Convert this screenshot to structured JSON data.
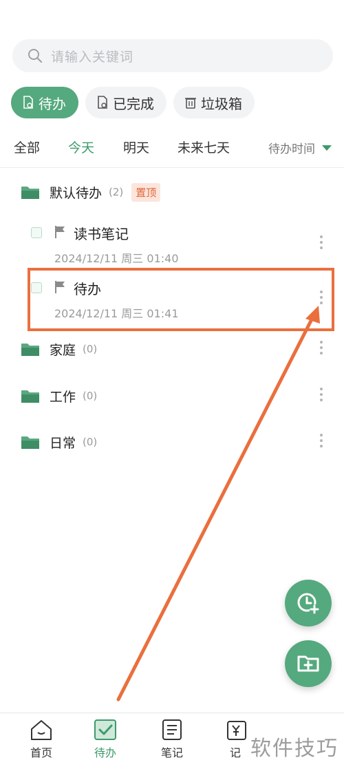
{
  "search": {
    "placeholder": "请输入关键词",
    "icon": "search-icon"
  },
  "chips": [
    {
      "label": "待办",
      "icon": "todo-doc-icon",
      "active": true
    },
    {
      "label": "已完成",
      "icon": "done-doc-icon",
      "active": false
    },
    {
      "label": "垃圾箱",
      "icon": "trash-icon",
      "active": false
    }
  ],
  "tabs": [
    {
      "label": "全部",
      "active": false
    },
    {
      "label": "今天",
      "active": true
    },
    {
      "label": "明天",
      "active": false
    },
    {
      "label": "未来七天",
      "active": false
    }
  ],
  "sort": {
    "label": "待办时间",
    "icon": "triangle-down-icon"
  },
  "folders": [
    {
      "name": "默认待办",
      "count": "(2)",
      "badge": "置顶",
      "tasks": [
        {
          "title": "读书笔记",
          "date": "2024/12/11 周三 01:40"
        },
        {
          "title": "待办",
          "date": "2024/12/11 周三 01:41"
        }
      ]
    },
    {
      "name": "家庭",
      "count": "(0)"
    },
    {
      "name": "工作",
      "count": "(0)"
    },
    {
      "name": "日常",
      "count": "(0)"
    }
  ],
  "fabs": [
    {
      "icon": "clock-add-icon"
    },
    {
      "icon": "folder-add-icon"
    }
  ],
  "bottom_nav": [
    {
      "label": "首页",
      "icon": "home-icon",
      "active": false
    },
    {
      "label": "待办",
      "icon": "todo-check-icon",
      "active": true
    },
    {
      "label": "笔记",
      "icon": "note-icon",
      "active": false
    },
    {
      "label": "记",
      "icon": "ledger-icon",
      "active": false
    }
  ],
  "watermark": "软件技巧",
  "colors": {
    "accent": "#55a97e",
    "accent_text": "#3d9a6b",
    "annotation": "#ea6f3d",
    "pin_bg": "#fbe5dc",
    "pin_text": "#e2673b"
  }
}
